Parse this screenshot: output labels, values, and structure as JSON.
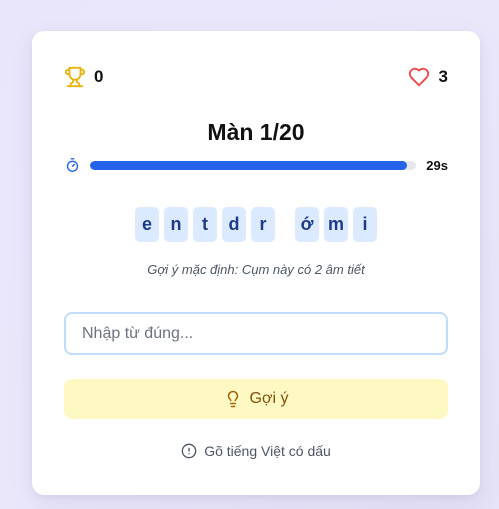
{
  "game": {
    "score": "0",
    "lives": "3",
    "level_title": "Màn 1/20",
    "time_remaining": "29s",
    "time_progress": 0.97,
    "scrambled_tiles": [
      "e",
      "n",
      "t",
      "d",
      "r",
      " ",
      "ớ",
      "m",
      "i"
    ],
    "hint_default": "Gợi ý mặc định: Cụm này có 2 âm tiết",
    "answer_input": {
      "value": "",
      "placeholder": "Nhập từ đúng..."
    },
    "hint_button_label": "Gợi ý",
    "footer_note": "Gõ tiếng Việt có dấu"
  },
  "colors": {
    "trophy": "#eab308",
    "heart": "#ef4444",
    "timer_icon": "#2563eb",
    "progress_fill": "#2563eb",
    "tile_bg": "#dbeafe",
    "tile_text": "#1e3a8a",
    "hint_button_bg": "#fef9c3",
    "hint_button_text": "#854d0e"
  },
  "icons": {
    "score": "trophy-icon",
    "lives": "heart-icon",
    "timer": "stopwatch-icon",
    "hint": "lightbulb-icon",
    "note": "info-circle-icon"
  }
}
